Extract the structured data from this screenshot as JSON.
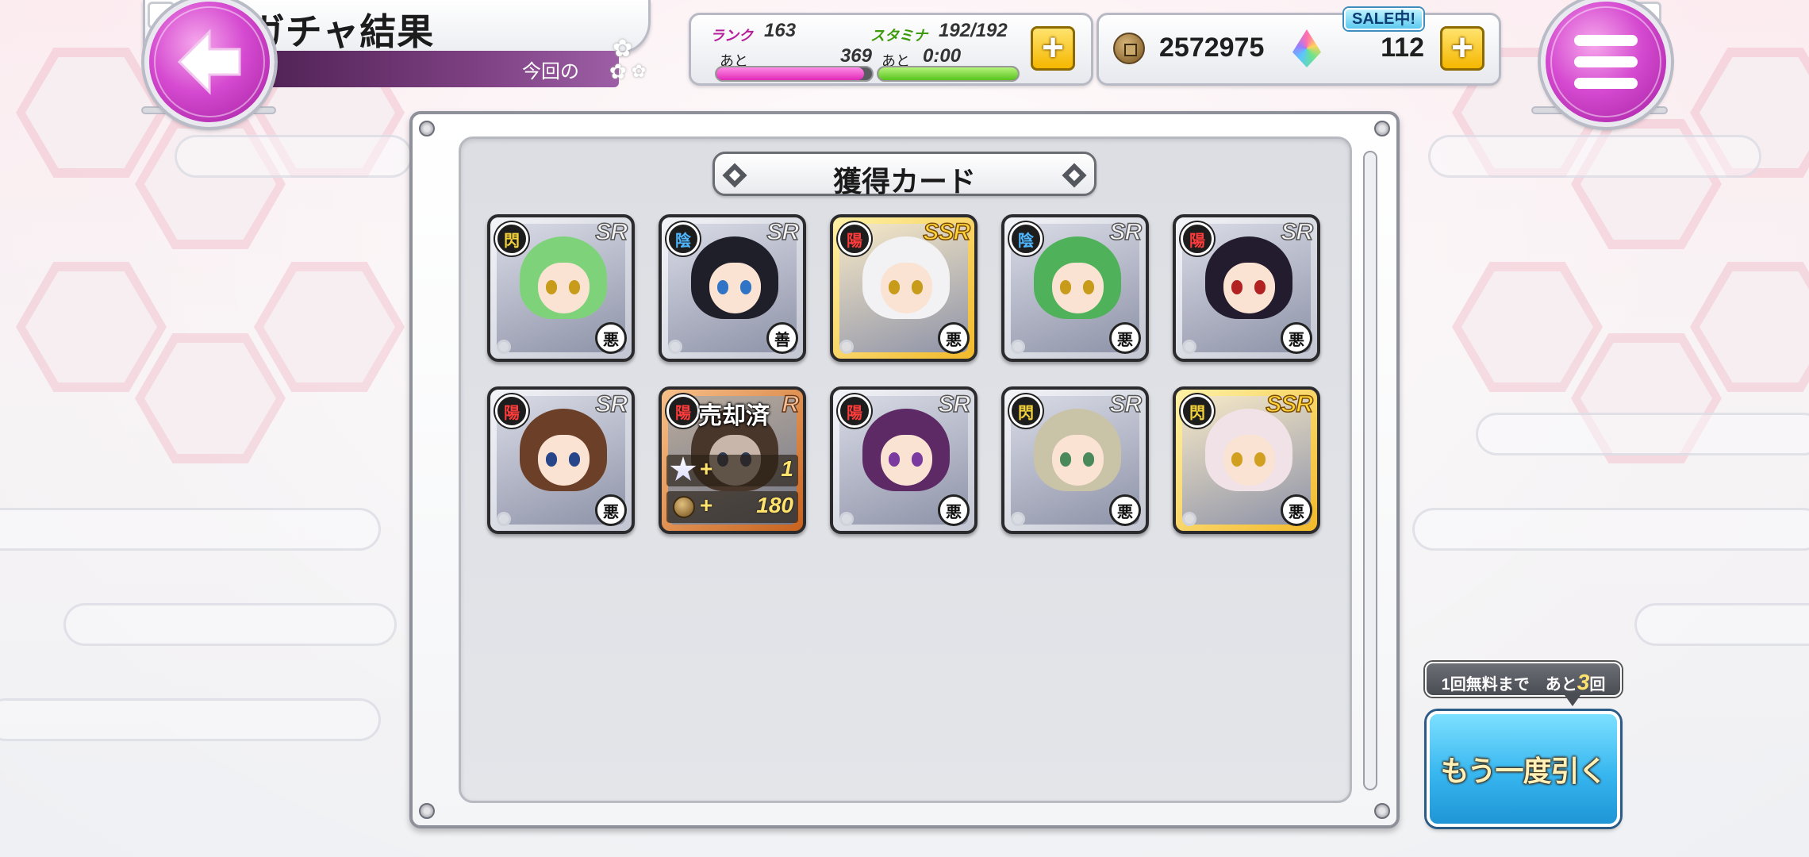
{
  "header": {
    "title": "ガチャ結果",
    "subtitle": "今回の"
  },
  "status": {
    "rank_label": "ランク",
    "rank_value": "163",
    "rank_remaining_label": "あと",
    "rank_remaining_value": "369",
    "exp_fill": 0.95,
    "stamina_label": "スタミナ",
    "stamina_value": "192/192",
    "stamina_remaining_label": "あと",
    "stamina_remaining_value": "0:00",
    "stamina_fill": 1.0,
    "coins": "2572975",
    "gems": "112",
    "sale_badge": "SALE中!"
  },
  "panel": {
    "header": "獲得カード"
  },
  "cards": [
    {
      "rarity": "SR",
      "attribute": "閃",
      "faction": "悪",
      "hair": "#7ed37a",
      "eye": "#c89b1a"
    },
    {
      "rarity": "SR",
      "attribute": "陰",
      "faction": "善",
      "hair": "#1f1f2a",
      "eye": "#2f74c5"
    },
    {
      "rarity": "SSR",
      "attribute": "陽",
      "faction": "悪",
      "hair": "#f2f2f4",
      "eye": "#c89b1a"
    },
    {
      "rarity": "SR",
      "attribute": "陰",
      "faction": "悪",
      "hair": "#4fb25a",
      "eye": "#c89b1a"
    },
    {
      "rarity": "SR",
      "attribute": "陽",
      "faction": "悪",
      "hair": "#221c2e",
      "eye": "#b32222"
    },
    {
      "rarity": "SR",
      "attribute": "陽",
      "faction": "悪",
      "hair": "#6b3f28",
      "eye": "#27468a"
    },
    {
      "rarity": "R",
      "attribute": "陽",
      "faction": "",
      "hair": "#5a4334",
      "eye": "#3a4a6a",
      "sold": true,
      "sold_label": "売却済",
      "sold_stars": "1",
      "sold_coins": "180",
      "plus": "+"
    },
    {
      "rarity": "SR",
      "attribute": "陽",
      "faction": "悪",
      "hair": "#5d2a66",
      "eye": "#7a3aa0"
    },
    {
      "rarity": "SR",
      "attribute": "閃",
      "faction": "悪",
      "hair": "#c9c3a8",
      "eye": "#4a8a5a"
    },
    {
      "rarity": "SSR",
      "attribute": "閃",
      "faction": "悪",
      "hair": "#f0e2e6",
      "eye": "#d1a020"
    }
  ],
  "draw_again": {
    "tooltip_prefix": "1回無料まで　あと",
    "tooltip_count": "3",
    "tooltip_suffix": "回",
    "label": "もう一度引く"
  },
  "colors": {
    "accent_purple": "#a41fa1",
    "draw_button": "#37b6ef",
    "plus_button": "#f5b700"
  }
}
